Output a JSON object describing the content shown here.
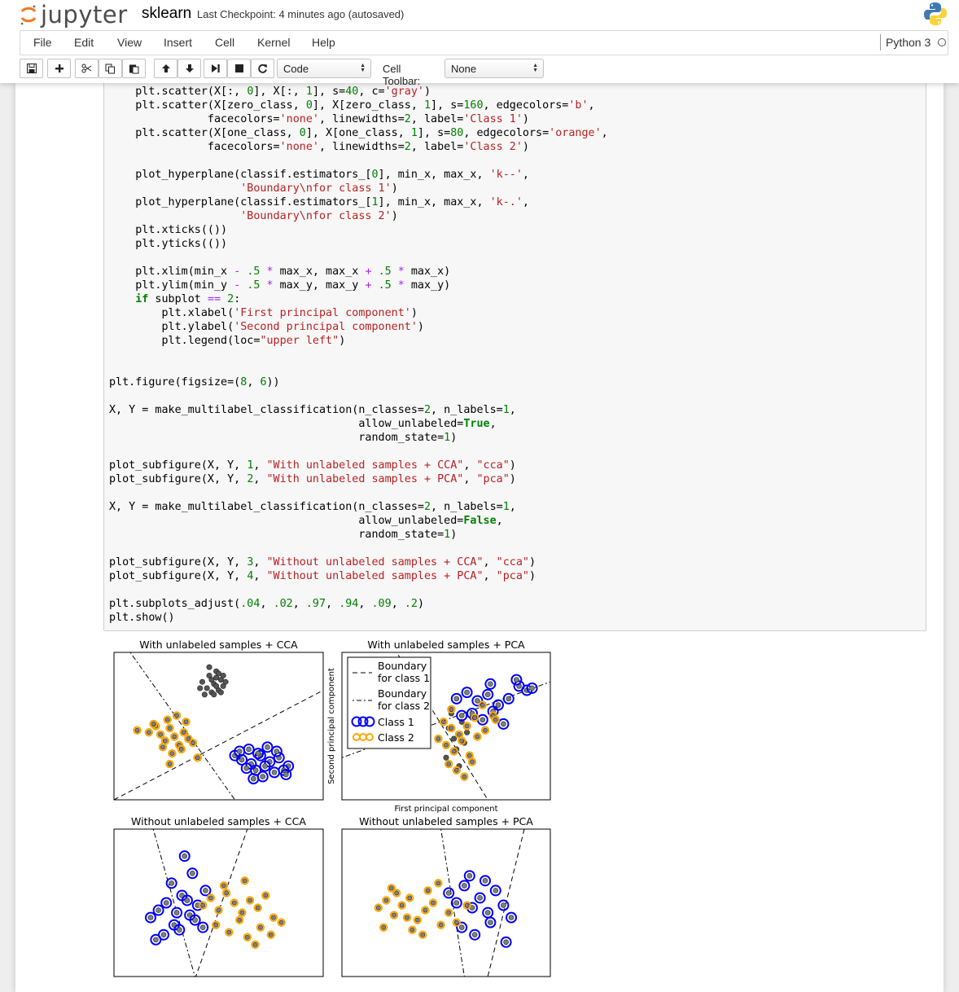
{
  "header": {
    "logo_text": "jupyter",
    "notebook_name": "sklearn",
    "checkpoint": "Last Checkpoint: 4 minutes ago (autosaved)"
  },
  "menu": {
    "items": [
      "File",
      "Edit",
      "View",
      "Insert",
      "Cell",
      "Kernel",
      "Help"
    ],
    "kernel_name": "Python 3"
  },
  "toolbar": {
    "cell_type": "Code",
    "cell_toolbar_label": "Cell Toolbar:",
    "cell_toolbar_value": "None",
    "buttons": [
      "save-icon",
      "plus-icon",
      "scissors-icon",
      "copy-icon",
      "paste-icon",
      "arrow-up-icon",
      "arrow-down-icon",
      "step-forward-icon",
      "stop-icon",
      "refresh-icon"
    ]
  },
  "code_cell": {
    "lines": [
      "    plt.scatter(X[:, 0], X[:, 1], s=40, c='gray')",
      "    plt.scatter(X[zero_class, 0], X[zero_class, 1], s=160, edgecolors='b',",
      "               facecolors='none', linewidths=2, label='Class 1')",
      "    plt.scatter(X[one_class, 0], X[one_class, 1], s=80, edgecolors='orange',",
      "               facecolors='none', linewidths=2, label='Class 2')",
      "",
      "    plot_hyperplane(classif.estimators_[0], min_x, max_x, 'k--',",
      "                    'Boundary\\nfor class 1')",
      "    plot_hyperplane(classif.estimators_[1], min_x, max_x, 'k-.',",
      "                    'Boundary\\nfor class 2')",
      "    plt.xticks(())",
      "    plt.yticks(())",
      "",
      "    plt.xlim(min_x - .5 * max_x, max_x + .5 * max_x)",
      "    plt.ylim(min_y - .5 * max_y, max_y + .5 * max_y)",
      "    if subplot == 2:",
      "        plt.xlabel('First principal component')",
      "        plt.ylabel('Second principal component')",
      "        plt.legend(loc=\"upper left\")",
      "",
      "",
      "plt.figure(figsize=(8, 6))",
      "",
      "X, Y = make_multilabel_classification(n_classes=2, n_labels=1,",
      "                                      allow_unlabeled=True,",
      "                                      random_state=1)",
      "",
      "plot_subfigure(X, Y, 1, \"With unlabeled samples + CCA\", \"cca\")",
      "plot_subfigure(X, Y, 2, \"With unlabeled samples + PCA\", \"pca\")",
      "",
      "X, Y = make_multilabel_classification(n_classes=2, n_labels=1,",
      "                                      allow_unlabeled=False,",
      "                                      random_state=1)",
      "",
      "plot_subfigure(X, Y, 3, \"Without unlabeled samples + CCA\", \"cca\")",
      "plot_subfigure(X, Y, 4, \"Without unlabeled samples + PCA\", \"pca\")",
      "",
      "plt.subplots_adjust(.04, .02, .97, .94, .09, .2)",
      "plt.show()"
    ]
  },
  "output": {
    "colors": {
      "class1": "#0000ff",
      "class2": "#ffa500",
      "unlabeled": "#808080"
    },
    "chart_data": [
      {
        "type": "scatter",
        "title": "With unlabeled samples + CCA",
        "xlabel": "",
        "ylabel": "",
        "series": [
          {
            "name": "",
            "color": "#808080",
            "x": [
              -1.2,
              -0.9,
              -0.6,
              -1.0,
              -0.7,
              -0.4,
              -0.8,
              -0.5,
              -0.3,
              -0.6,
              -1.1,
              -0.2,
              -0.9,
              -0.5,
              -0.7,
              -0.4,
              -0.8,
              -0.3,
              -1.3,
              -0.6
            ],
            "y": [
              2.6,
              2.9,
              3.1,
              2.3,
              2.5,
              2.7,
              2.1,
              2.2,
              2.4,
              2.8,
              2.0,
              2.6,
              3.3,
              3.0,
              2.0,
              2.1,
              2.7,
              2.9,
              2.3,
              2.4
            ]
          },
          {
            "name": "Class 1",
            "color": "#0000ff",
            "x": [
              0.2,
              0.5,
              0.9,
              1.3,
              1.7,
              2.1,
              2.5,
              0.7,
              1.1,
              1.5,
              1.9,
              2.3,
              0.4,
              0.8,
              1.2,
              1.6,
              2.0,
              2.4,
              1.0,
              1.4
            ],
            "y": [
              -0.9,
              -1.1,
              -1.3,
              -0.9,
              -1.2,
              -1.0,
              -1.4,
              -1.5,
              -1.6,
              -1.4,
              -1.7,
              -1.6,
              -0.7,
              -0.6,
              -0.8,
              -0.5,
              -0.7,
              -1.8,
              -2.0,
              -1.9
            ]
          },
          {
            "name": "Class 2",
            "color": "#ffa500",
            "x": [
              -4.0,
              -3.5,
              -3.2,
              -3.0,
              -2.8,
              -2.6,
              -2.4,
              -2.2,
              -2.0,
              -1.8,
              -2.9,
              -2.5,
              -2.1,
              -1.6,
              -3.3,
              -2.7,
              -2.3,
              -1.9,
              -1.4,
              -2.6
            ],
            "y": [
              0.3,
              0.2,
              0.5,
              0.1,
              -0.2,
              0.4,
              0.0,
              -0.4,
              0.2,
              -0.1,
              -0.5,
              -0.8,
              -0.6,
              -0.3,
              0.6,
              0.8,
              1.0,
              0.7,
              -1.0,
              -1.3
            ]
          }
        ]
      },
      {
        "type": "scatter",
        "title": "With unlabeled samples + PCA",
        "xlabel": "First principal component",
        "ylabel": "Second principal component",
        "legend": {
          "placement": "upper-left",
          "entries": [
            "Boundary\nfor class 1",
            "Boundary\nfor class 2",
            "Class 1",
            "Class 2"
          ]
        },
        "series": [
          {
            "name": "",
            "color": "#808080",
            "x": [
              0.3,
              0.5,
              0.8,
              1.0,
              0.6,
              0.2,
              1.2,
              0.9,
              0.4,
              0.7
            ],
            "y": [
              0.2,
              -0.3,
              0.5,
              0.0,
              -0.8,
              -1.2,
              0.7,
              -0.5,
              0.9,
              -1.6
            ]
          },
          {
            "name": "Class 1",
            "color": "#0000ff",
            "x": [
              0.6,
              1.0,
              1.4,
              1.8,
              2.2,
              2.6,
              3.0,
              3.3,
              1.2,
              1.6,
              2.0,
              2.4,
              0.8,
              1.9,
              2.9,
              3.5
            ],
            "y": [
              1.6,
              1.9,
              1.5,
              1.8,
              1.3,
              1.6,
              2.2,
              2.0,
              0.9,
              0.6,
              1.0,
              0.4,
              0.8,
              2.3,
              2.5,
              2.1
            ]
          },
          {
            "name": "Class 2",
            "color": "#ffa500",
            "x": [
              0.1,
              0.4,
              0.7,
              1.0,
              1.3,
              0.2,
              0.5,
              0.8,
              1.1,
              1.4,
              1.7,
              2.0,
              0.3,
              0.6,
              0.9,
              1.2,
              -0.1,
              0.4,
              1.6,
              2.1
            ],
            "y": [
              0.5,
              0.2,
              -0.1,
              0.3,
              0.7,
              -0.6,
              -0.9,
              -0.4,
              -1.1,
              -0.2,
              0.1,
              0.8,
              -1.5,
              -1.8,
              -2.1,
              -1.4,
              -0.3,
              1.1,
              1.3,
              0.6
            ]
          }
        ]
      },
      {
        "type": "scatter",
        "title": "Without unlabeled samples + CCA",
        "xlabel": "",
        "ylabel": "",
        "series": [
          {
            "name": "Class 1",
            "color": "#0000ff",
            "x": [
              -2.6,
              -2.3,
              -2.0,
              -1.7,
              -1.4,
              -1.1,
              -0.8,
              -0.5,
              -2.1,
              -1.8,
              -1.5,
              -1.2,
              -0.9,
              -2.4,
              -1.6,
              -1.0,
              -0.6,
              -1.3
            ],
            "y": [
              -0.2,
              0.1,
              0.4,
              -0.5,
              0.7,
              -0.1,
              0.3,
              0.9,
              -0.9,
              1.2,
              -0.7,
              0.5,
              -0.3,
              -1.1,
              0.0,
              1.6,
              -0.6,
              2.3
            ]
          },
          {
            "name": "Class 2",
            "color": "#ffa500",
            "x": [
              -0.6,
              -0.3,
              0.0,
              0.3,
              0.6,
              0.9,
              1.2,
              1.5,
              1.8,
              2.1,
              -0.1,
              0.4,
              0.8,
              1.1,
              1.6,
              2.4,
              0.2,
              1.0,
              1.4,
              2.0
            ],
            "y": [
              0.3,
              0.6,
              0.1,
              0.8,
              0.4,
              0.0,
              0.5,
              0.2,
              0.7,
              -0.2,
              -0.5,
              -0.8,
              -0.3,
              -1.0,
              -0.6,
              -0.4,
              1.1,
              1.3,
              -1.3,
              -0.9
            ]
          }
        ]
      },
      {
        "type": "scatter",
        "title": "Without unlabeled samples + PCA",
        "xlabel": "",
        "ylabel": "",
        "series": [
          {
            "name": "Class 1",
            "color": "#0000ff",
            "x": [
              0.1,
              0.4,
              0.7,
              1.0,
              1.3,
              1.6,
              1.9,
              2.2,
              2.5,
              0.6,
              1.1,
              1.7,
              2.3,
              0.9,
              1.5
            ],
            "y": [
              0.8,
              0.4,
              1.1,
              0.2,
              0.6,
              0.0,
              0.9,
              0.3,
              -0.2,
              -0.6,
              -0.9,
              -0.4,
              -1.2,
              1.5,
              1.3
            ]
          },
          {
            "name": "Class 2",
            "color": "#ffa500",
            "x": [
              -2.6,
              -2.3,
              -2.0,
              -1.7,
              -1.4,
              -1.1,
              -0.8,
              -0.5,
              -0.2,
              0.1,
              -2.4,
              -1.9,
              -1.3,
              -0.7,
              -2.1,
              -1.5,
              -0.9,
              -0.3,
              0.4,
              0.8
            ],
            "y": [
              0.2,
              0.5,
              -0.1,
              0.3,
              0.6,
              -0.3,
              0.1,
              0.4,
              -0.5,
              0.0,
              -0.6,
              0.8,
              -0.7,
              0.9,
              1.0,
              -0.2,
              -0.9,
              1.2,
              -0.4,
              0.3
            ]
          }
        ]
      }
    ]
  }
}
